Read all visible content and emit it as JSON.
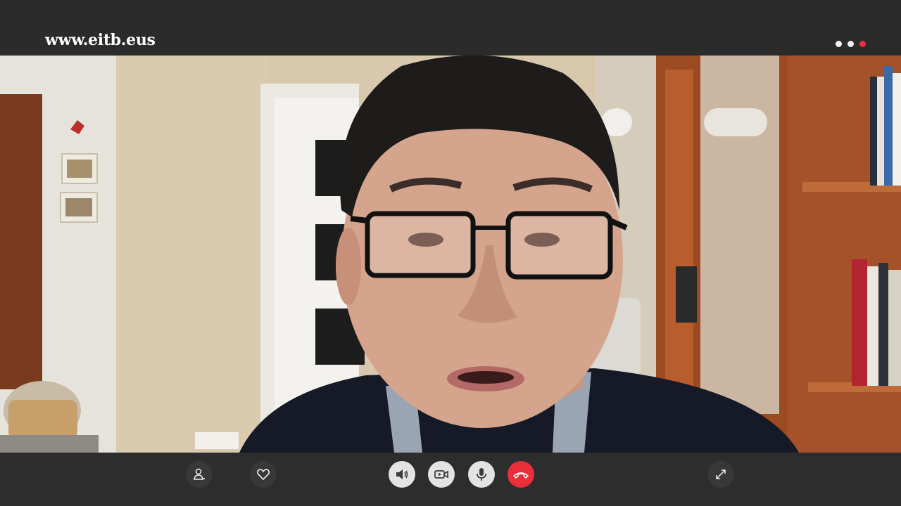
{
  "header": {
    "brand": "www.eitb.eus",
    "menu_dots": [
      "dot",
      "dot",
      "dot-red"
    ]
  },
  "video_call": {
    "participant": "video-feed"
  },
  "controls": {
    "contacts_icon": "user-icon",
    "favorite_icon": "heart-icon",
    "speaker_icon": "speaker-icon",
    "camera_icon": "camera-icon",
    "mic_icon": "microphone-icon",
    "hangup_icon": "phone-hangup-icon",
    "fullscreen_icon": "expand-icon"
  },
  "colors": {
    "accent_red": "#ea2f3a",
    "bar_bg": "#2d2d2d",
    "button_grey": "#e3e3e3"
  }
}
